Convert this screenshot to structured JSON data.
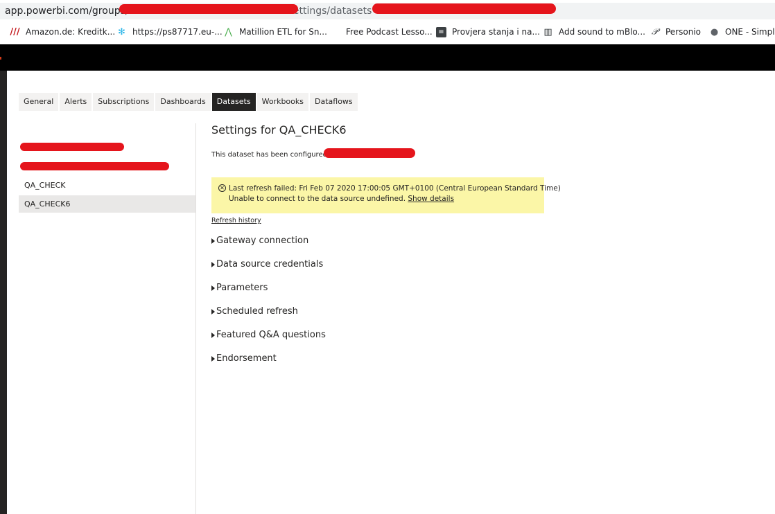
{
  "browser": {
    "url_prefix": "app.powerbi.com/groups/",
    "url_suffix": "settings/datasets",
    "bookmarks": [
      {
        "label": "Amazon.de: Kreditk...",
        "icon": "amazon-stripes-icon",
        "color": "#c41a1f"
      },
      {
        "label": "https://ps87717.eu-...",
        "icon": "snowflake-icon",
        "color": "#29b5e8"
      },
      {
        "label": "Matillion ETL for Sn...",
        "icon": "matillion-icon",
        "color": "#4caf50"
      },
      {
        "label": "Free Podcast Lesso...",
        "icon": "",
        "color": ""
      },
      {
        "label": "Provjera stanja i na...",
        "icon": "document-icon",
        "color": "#3c4043"
      },
      {
        "label": "Add sound to mBlo...",
        "icon": "book-icon",
        "color": "#3c4043"
      },
      {
        "label": "Personio",
        "icon": "personio-icon",
        "color": "#3c4043"
      },
      {
        "label": "ONE - Simply",
        "icon": "globe-icon",
        "color": "#5f6368"
      }
    ]
  },
  "tabs": [
    "General",
    "Alerts",
    "Subscriptions",
    "Dashboards",
    "Datasets",
    "Workbooks",
    "Dataflows"
  ],
  "active_tab": "Datasets",
  "datasets": [
    "QA_CHECK",
    "QA_CHECK6"
  ],
  "selected_dataset": "QA_CHECK6",
  "main": {
    "title": "Settings for QA_CHECK6",
    "configured_by": "This dataset has been configured by",
    "alert": {
      "line1": "Last refresh failed: Fri Feb 07 2020 17:00:05 GMT+0100 (Central European Standard Time)",
      "line2": "Unable to connect to the data source undefined.",
      "link": "Show details",
      "background": "#fbf6a7"
    },
    "refresh_history": "Refresh history",
    "sections": [
      "Gateway connection",
      "Data source credentials",
      "Parameters",
      "Scheduled refresh",
      "Featured Q&A questions",
      "Endorsement"
    ]
  },
  "colors": {
    "active_tab_bg": "#252423",
    "redaction": "#e5151c",
    "topbar": "#000000"
  }
}
